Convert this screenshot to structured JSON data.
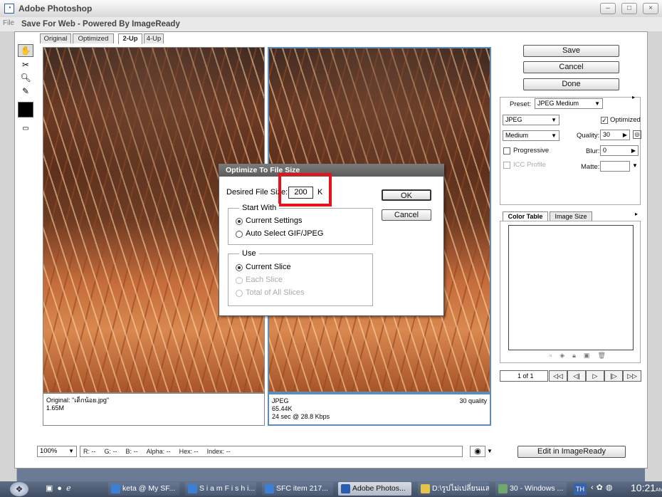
{
  "window": {
    "app_title": "Adobe Photoshop",
    "dialog_title": "Save For Web - Powered By ImageReady",
    "menu_stub": "File"
  },
  "tabs": [
    "Original",
    "Optimized",
    "2-Up",
    "4-Up"
  ],
  "active_tab": "2-Up",
  "left_info": {
    "line1": "Original: \"เด็กน้อย.jpg\"",
    "line2": "1.65M"
  },
  "right_info": {
    "format": "JPEG",
    "size": "65.44K",
    "time": "24 sec @ 28.8 Kbps",
    "quality": "30 quality"
  },
  "status": {
    "zoom": "100%",
    "fields": [
      "R:",
      "--",
      "G:",
      "--",
      "B:",
      "--",
      "Alpha:",
      "--",
      "Hex:",
      "--",
      "Index:",
      "--"
    ]
  },
  "buttons": {
    "save": "Save",
    "cancel": "Cancel",
    "done": "Done",
    "edit_imageready": "Edit in ImageReady"
  },
  "settings": {
    "preset_label": "Preset:",
    "preset_value": "JPEG Medium",
    "format": "JPEG",
    "optimized_label": "Optimized",
    "compression": "Medium",
    "quality_label": "Quality:",
    "quality_value": "30",
    "progressive_label": "Progressive",
    "blur_label": "Blur:",
    "blur_value": "0",
    "icc_label": "ICC Profile",
    "matte_label": "Matte:"
  },
  "panel_tabs": {
    "color_table": "Color Table",
    "image_size": "Image Size"
  },
  "frames": {
    "counter": "1 of 1",
    "buttons": [
      "◁◁",
      "◁|",
      "▷",
      "|▷",
      "▷▷"
    ]
  },
  "optimize_dialog": {
    "title": "Optimize To File Size",
    "desired_label": "Desired File Size:",
    "size_value": "200",
    "unit": "K",
    "ok": "OK",
    "cancel": "Cancel",
    "start_with": "Start With",
    "opt_current_settings": "Current Settings",
    "opt_auto_select": "Auto Select GIF/JPEG",
    "use": "Use",
    "opt_current_slice": "Current Slice",
    "opt_each_slice": "Each Slice",
    "opt_total_slices": "Total of All Slices"
  },
  "taskbar": {
    "items": [
      "keta @ My SF...",
      "S i a m F i s h i...",
      "SFC item 217...",
      "Adobe Photos...",
      "D:\\รูปไม่เปลี่ยนแล",
      "30 - Windows ..."
    ],
    "lang": "TH",
    "clock": "10:21",
    "clock_ampm": "AM"
  },
  "colors": {
    "highlight_red": "#e8121c",
    "accent_blue": "#5c8cb8"
  }
}
